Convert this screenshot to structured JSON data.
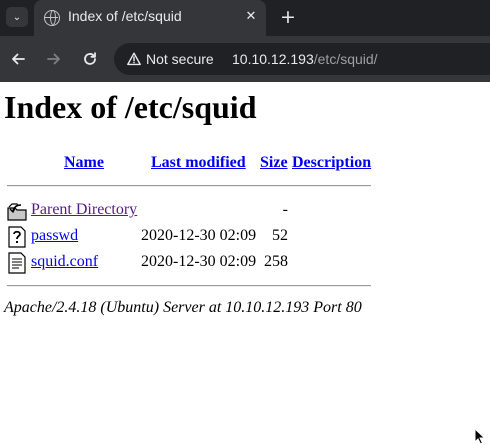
{
  "browser": {
    "tab_title": "Index of /etc/squid",
    "security_label": "Not secure",
    "url_host": "10.10.12.193",
    "url_path": "/etc/squid/",
    "icons": {
      "tab_menu": "chevron-down-icon",
      "favicon": "globe-icon",
      "tab_close": "close-icon",
      "new_tab": "plus-icon",
      "back": "back-arrow-icon",
      "forward": "forward-arrow-icon",
      "reload": "reload-icon",
      "security": "warning-triangle-icon"
    }
  },
  "page": {
    "heading": "Index of /etc/squid",
    "columns": [
      "Name",
      "Last modified",
      "Size",
      "Description"
    ],
    "rows": [
      {
        "icon": "folder-back-icon",
        "name": "Parent Directory",
        "modified": "",
        "size": "-",
        "visited": true
      },
      {
        "icon": "unknown-file-icon",
        "name": "passwd",
        "modified": "2020-12-30 02:09",
        "size": "52",
        "visited": false
      },
      {
        "icon": "text-file-icon",
        "name": "squid.conf",
        "modified": "2020-12-30 02:09",
        "size": "258",
        "visited": false
      }
    ],
    "footer": "Apache/2.4.18 (Ubuntu) Server at 10.10.12.193 Port 80"
  },
  "colors": {
    "link": "#0000ee",
    "visited_link": "#551a8b",
    "chrome_dark": "#202124",
    "chrome_toolbar": "#35363a"
  }
}
